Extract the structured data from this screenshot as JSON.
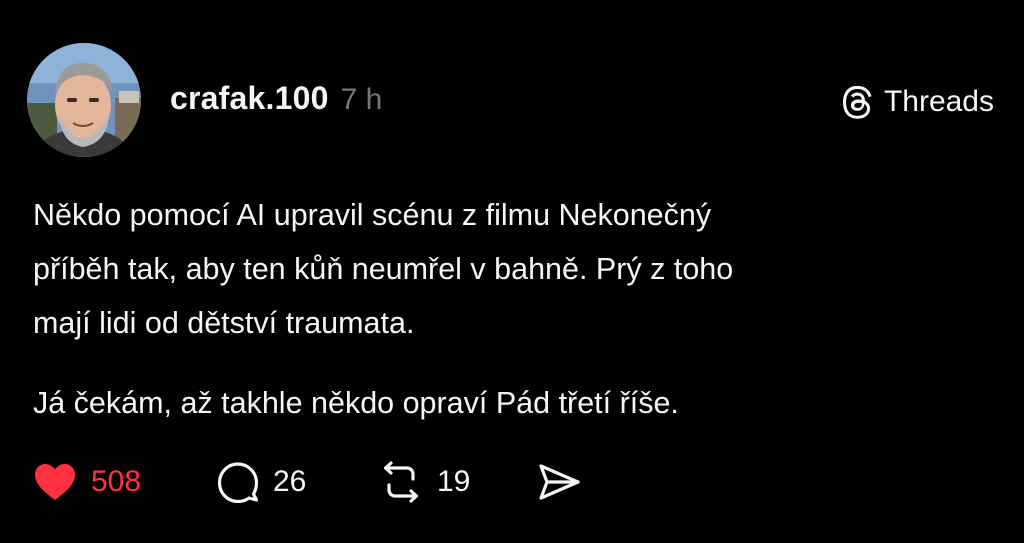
{
  "post": {
    "author": {
      "username": "crafak.100",
      "avatar_icon": "profile-photo"
    },
    "timestamp": "7 h",
    "brand": {
      "label": "Threads",
      "icon": "threads-logo-icon"
    },
    "body": {
      "paragraph_1": "Někdo pomocí AI upravil scénu z filmu Nekonečný\npříběh tak, aby ten kůň neumřel v bahně. Prý z toho\nmají lidi od dětství traumata.",
      "paragraph_2": "Já čekám, až takhle někdo opraví Pád třetí říše."
    },
    "actions": {
      "likes": "508",
      "replies": "26",
      "reposts": "19",
      "like_icon": "heart-icon",
      "reply_icon": "comment-bubble-icon",
      "repost_icon": "repost-icon",
      "share_icon": "send-icon"
    },
    "colors": {
      "background": "#000000",
      "text": "#f3f5f7",
      "muted": "#777777",
      "like": "#ff3040"
    }
  }
}
